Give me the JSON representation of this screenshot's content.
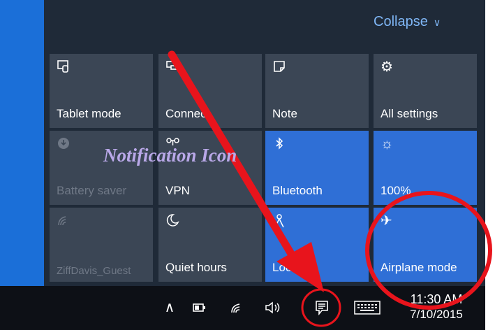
{
  "header": {
    "collapse_label": "Collapse"
  },
  "tiles": [
    {
      "label": "Tablet mode",
      "icon": "tablet-mode-icon",
      "state": "off"
    },
    {
      "label": "Connect",
      "icon": "connect-icon",
      "state": "off"
    },
    {
      "label": "Note",
      "icon": "note-icon",
      "state": "off"
    },
    {
      "label": "All settings",
      "icon": "gear-icon",
      "state": "off"
    },
    {
      "label": "Battery saver",
      "icon": "battery-saver-icon",
      "state": "disabled"
    },
    {
      "label": "VPN",
      "icon": "vpn-icon",
      "state": "off"
    },
    {
      "label": "Bluetooth",
      "icon": "bluetooth-icon",
      "state": "on"
    },
    {
      "label": "100%",
      "icon": "brightness-icon",
      "state": "on"
    },
    {
      "label": "ZiffDavis_Guest",
      "icon": "wifi-icon",
      "state": "disabled"
    },
    {
      "label": "Quiet hours",
      "icon": "moon-icon",
      "state": "off"
    },
    {
      "label": "Location",
      "icon": "location-icon",
      "state": "on"
    },
    {
      "label": "Airplane mode",
      "icon": "airplane-icon",
      "state": "on"
    }
  ],
  "annotation": {
    "text": "Notification Icon"
  },
  "taskbar": {
    "clock": {
      "time": "11:30 AM",
      "date": "7/10/2015"
    },
    "icons": [
      "chevron-up-icon",
      "power-icon",
      "wifi-icon",
      "volume-icon",
      "notification-icon",
      "keyboard-icon"
    ]
  },
  "colors": {
    "accent": "#2f6fd6",
    "tile": "#3b4655",
    "panel": "#1f2a38",
    "taskbar": "#0d1016",
    "annotation_red": "#e8141c"
  }
}
